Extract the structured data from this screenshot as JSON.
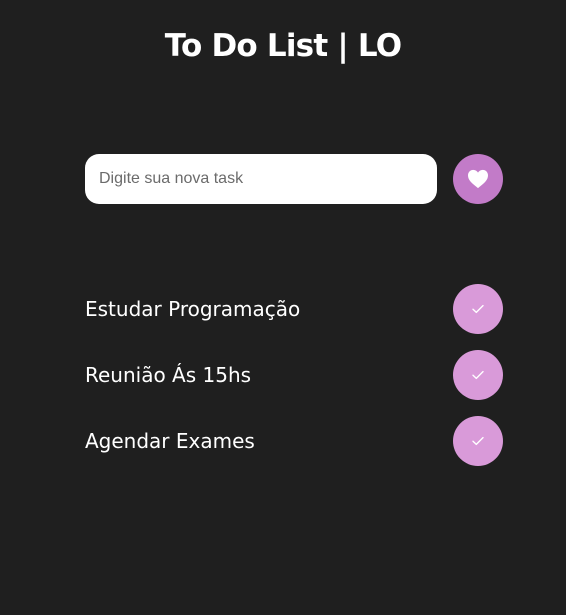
{
  "header": {
    "title": "To Do List | LO"
  },
  "new_task": {
    "placeholder": "Digite sua nova task",
    "value": "",
    "add_button_icon": "heart-icon"
  },
  "tasks": [
    {
      "text": "Estudar Programação",
      "done_icon": "check-icon"
    },
    {
      "text": "Reunião Ás 15hs",
      "done_icon": "check-icon"
    },
    {
      "text": "Agendar Exames",
      "done_icon": "check-icon"
    }
  ],
  "colors": {
    "background": "#1f1f1f",
    "add_button": "#c27bc8",
    "check_button": "#d99ad9",
    "text": "#ffffff"
  }
}
